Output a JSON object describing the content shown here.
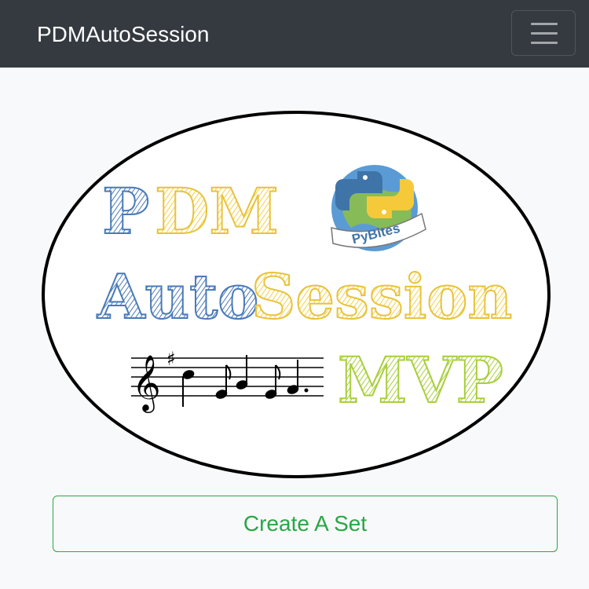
{
  "navbar": {
    "brand": "PDMAutoSession",
    "toggler_icon": "hamburger-menu-icon"
  },
  "logo": {
    "line1": {
      "P": "P",
      "DM": "DM"
    },
    "line2": {
      "auto": "Auto",
      "session": "Session"
    },
    "line3": "MVP",
    "badge_text": "PyBites",
    "badge_icon": "python-pybites-badge-icon",
    "staff_icon": "music-staff-icon"
  },
  "actions": {
    "create_set_label": "Create A Set"
  },
  "colors": {
    "navbar_bg": "#343a40",
    "page_bg": "#f8f9fa",
    "button_green": "#28a745",
    "logo_blue": "#4a7ab8",
    "logo_yellow": "#f5d04a",
    "logo_green": "#a8cf3c"
  }
}
